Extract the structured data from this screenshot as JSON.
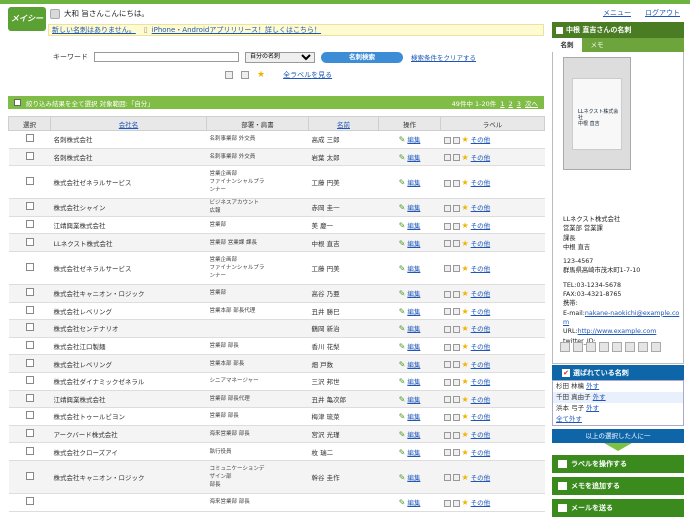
{
  "app": {
    "logo": "メイシー"
  },
  "header": {
    "greeting": "大和 旨さんこんにちは。",
    "menu_label": "メニュー",
    "logout_label": "ログアウト"
  },
  "notice": {
    "no_new_cards": "新しい名刺はありません。",
    "app_release": "iPhone・Androidアプリリリース！詳しくはこちら！"
  },
  "search": {
    "keyword_label": "キーワード",
    "keyword_value": "",
    "scope_selected": "自分の名刺",
    "search_button": "名刺検索",
    "clear_link": "検索条件をクリアする"
  },
  "label_toolbar": {
    "all_labels_link": "全ラベルを見る"
  },
  "list_bar": {
    "select_all": "絞り込み結果を全て選択 対象範囲:「自分」",
    "count": "49件中 1-20件",
    "pages": [
      "1",
      "2",
      "3"
    ],
    "next": "次へ"
  },
  "table": {
    "headers": [
      "選択",
      "会社名",
      "部署・肩書",
      "名前",
      "操作",
      "ラベル"
    ],
    "edit_label": "編集",
    "more_label": "その他",
    "rows": [
      {
        "company": "名刺株式会社",
        "dept": "名刺事業部 外交員",
        "name": "高成 三郎"
      },
      {
        "company": "名刺株式会社",
        "dept": "名刺事業部 外交員",
        "name": "岩葉 太郎"
      },
      {
        "company": "株式会社ゼネラルサービス",
        "dept": "営業企画部\nファイナンシャルプラ\nンナー",
        "name": "工藤 円美"
      },
      {
        "company": "株式会社シャイン",
        "dept": "ビジネスアカウント\n広報",
        "name": "赤岡 圭一"
      },
      {
        "company": "江靖興業株式会社",
        "dept": "営業部",
        "name": "美 慶一"
      },
      {
        "company": "LLネクスト株式会社",
        "dept": "営業部 営業課 課長",
        "name": "中根 直吉"
      },
      {
        "company": "株式会社ゼネラルサービス",
        "dept": "営業企画部\nファイナンシャルプラ\nンナー",
        "name": "工藤 円美"
      },
      {
        "company": "株式会社キャニオン・ロジック",
        "dept": "営業部",
        "name": "高谷 乃亜"
      },
      {
        "company": "株式会社レベリング",
        "dept": "営業本部 部長代理",
        "name": "丑井 勝巳"
      },
      {
        "company": "株式会社センテナリオ",
        "dept": "",
        "name": "鶴岡 新治"
      },
      {
        "company": "株式会社江口製麺",
        "dept": "営業部 部長",
        "name": "香川 花梨"
      },
      {
        "company": "株式会社レベリング",
        "dept": "営業本部 部長",
        "name": "畑 戸数"
      },
      {
        "company": "株式会社ダイナミックゼネラル",
        "dept": "シニアマネージャー",
        "name": "三沢 邦世"
      },
      {
        "company": "江靖興業株式会社",
        "dept": "営業部 部長代理",
        "name": "丑井 亀次郎"
      },
      {
        "company": "株式会社トゥールビヨン",
        "dept": "営業部 部長",
        "name": "梅津 琉菜"
      },
      {
        "company": "アークバード株式会社",
        "dept": "海来営業部 部長",
        "name": "宮沢 光瑾"
      },
      {
        "company": "株式会社クローズアイ",
        "dept": "執行役員",
        "name": "枚 瑞二"
      },
      {
        "company": "株式会社キャニオン・ロジック",
        "dept": "コミュニケーションデ\nザイン部\n部長",
        "name": "幹谷 圭作"
      },
      {
        "company": "",
        "dept": "海来営業部 部長",
        "name": ""
      }
    ]
  },
  "card_panel": {
    "title": "中根 直吉さんの名刺",
    "tabs": [
      "名刺",
      "メモ"
    ],
    "card_image_text": [
      "LLネクスト株式会社",
      "中根 直吉"
    ],
    "company": "LLネクスト株式会社",
    "dept": "営業部 営業課",
    "position": "課長",
    "name": "中根 直吉",
    "postal": "123-4567",
    "address": "群馬県高崎市茂木町1-7-10",
    "tel": "TEL:03-1234-5678",
    "fax": "FAX:03-4321-8765",
    "mobile": "携帯:",
    "email_label": "E-mail:",
    "email": "nakane-naokichi@example.com",
    "url_label": "URL:",
    "url": "http://www.example.com",
    "twitter": "twitter_ID:"
  },
  "selected_panel": {
    "title": "選ばれている名刺",
    "items": [
      {
        "name": "杉田 林檎",
        "action": "外す"
      },
      {
        "name": "千田 真由子",
        "action": "外す"
      },
      {
        "name": "浜本 弓子",
        "action": "外す"
      }
    ],
    "clear_all": "全て外す",
    "note": "以上の選択した人に一",
    "actions": [
      "ラベルを操作する",
      "メモを追加する",
      "メールを送る"
    ]
  }
}
